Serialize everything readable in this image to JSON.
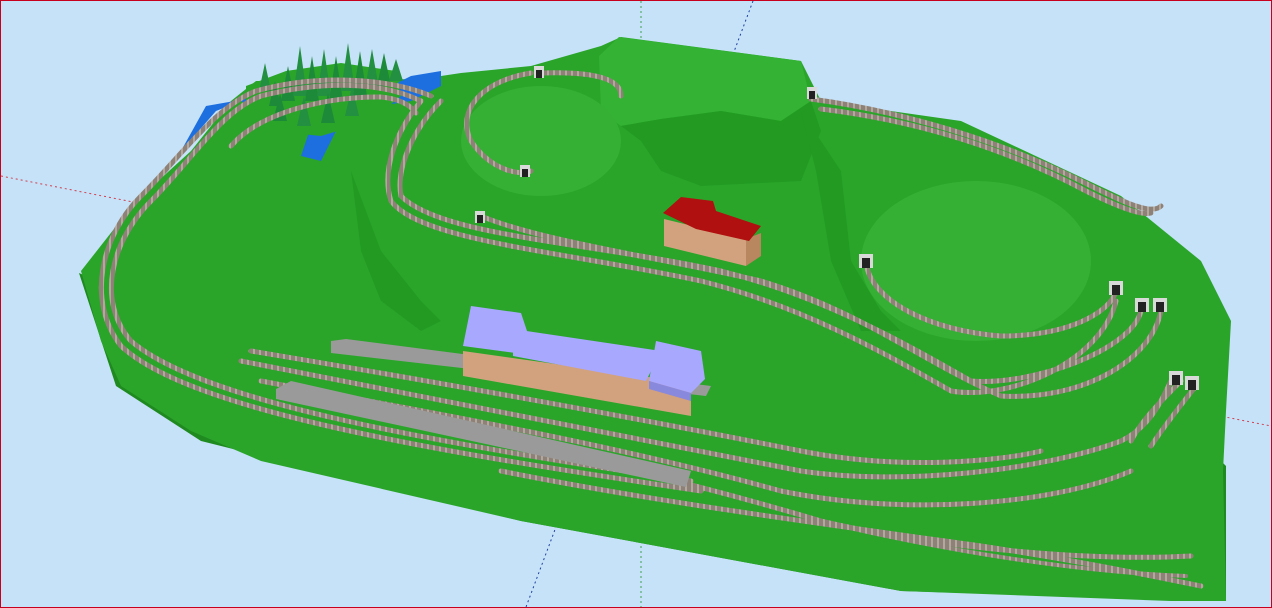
{
  "scene": {
    "background_color": "#c6e2f8",
    "border_color": "#c8001e",
    "terrain_color": "#2aa52a",
    "terrain_shadow_color": "#1f8a1f",
    "water_color": "#1d6fe0",
    "track_color": "#9a8c80",
    "station_roof_color": "#a8a8ff",
    "station_wall_color": "#d2a27e",
    "house_roof_color": "#b01010",
    "tree_color": "#1d8a3a",
    "axis_red": "#d04050",
    "axis_green": "#40a050",
    "axis_blue": "#2040a0",
    "icons": [
      "tunnel-portal-icon",
      "tree-icon",
      "station-building-icon",
      "house-icon"
    ]
  }
}
